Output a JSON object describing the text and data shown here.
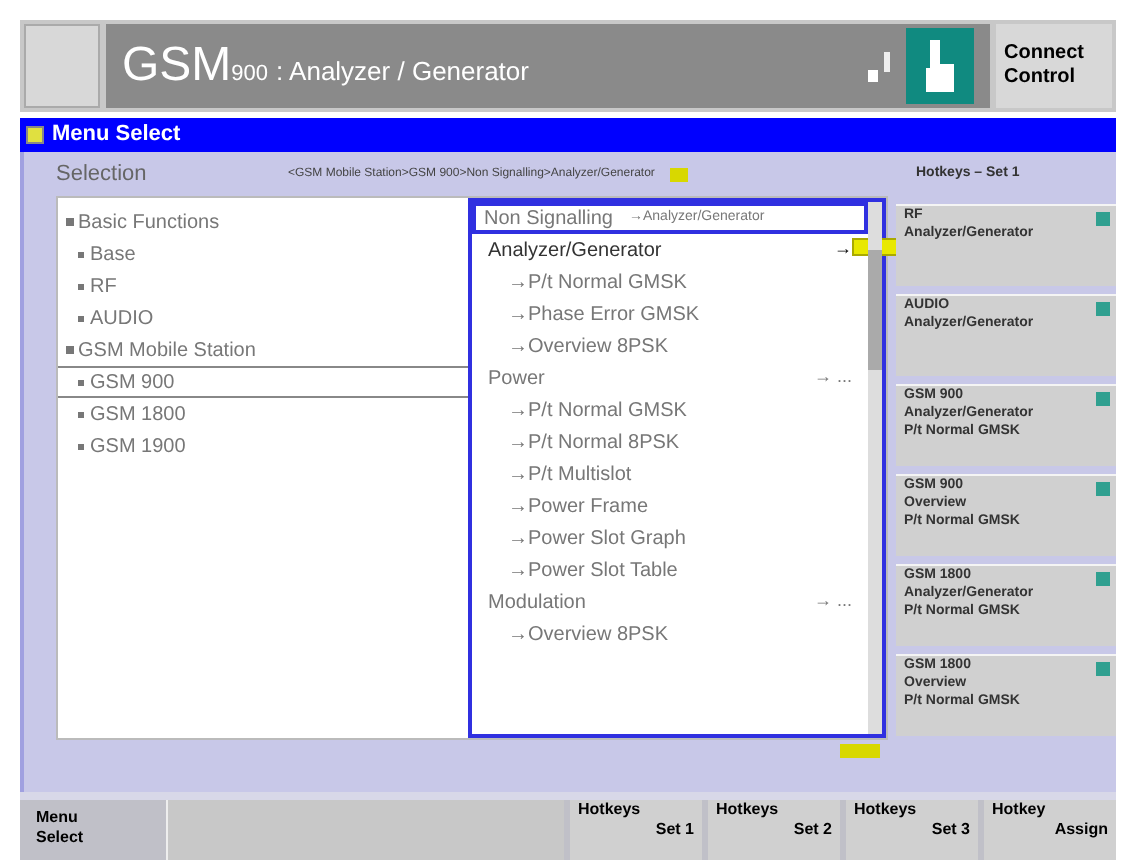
{
  "header": {
    "title_main": "GSM",
    "title_band": "900",
    "title_rest": ": Analyzer / Generator",
    "connect_button": "Connect\nControl"
  },
  "menu_bar": {
    "title": "Menu Select"
  },
  "selection": {
    "label": "Selection",
    "path": "<GSM Mobile Station>GSM 900>Non Signalling>Analyzer/Generator",
    "hotkeys_label": "Hotkeys – Set 1"
  },
  "left_tree": [
    {
      "label": "Basic Functions",
      "expanded": true,
      "selected": false,
      "children": [
        {
          "label": "Base",
          "selected": false
        },
        {
          "label": "RF",
          "selected": false
        },
        {
          "label": "AUDIO",
          "selected": false
        }
      ]
    },
    {
      "label": "GSM Mobile Station",
      "expanded": true,
      "selected": false,
      "children": [
        {
          "label": "GSM 900",
          "selected": true
        },
        {
          "label": "GSM 1800",
          "selected": false
        },
        {
          "label": "GSM 1900",
          "selected": false
        }
      ]
    }
  ],
  "right_header": {
    "label": "Non Signalling",
    "sub": "→Analyzer/Generator"
  },
  "right_tree": [
    {
      "label": "Analyzer/Generator",
      "marker": "→",
      "selected": true,
      "children": [
        {
          "label": "→P/t Normal GMSK"
        },
        {
          "label": "→Phase Error GMSK"
        },
        {
          "label": "→Overview 8PSK"
        }
      ]
    },
    {
      "label": "Power",
      "marker": "→ ...",
      "selected": false,
      "children": [
        {
          "label": "→P/t Normal GMSK"
        },
        {
          "label": "→P/t Normal 8PSK"
        },
        {
          "label": "→P/t Multislot"
        },
        {
          "label": "→Power Frame"
        },
        {
          "label": "→Power Slot Graph"
        },
        {
          "label": "→Power Slot Table"
        }
      ]
    },
    {
      "label": "Modulation",
      "marker": "→ ...",
      "selected": false,
      "children": [
        {
          "label": "→Overview 8PSK"
        }
      ]
    }
  ],
  "softkeys": [
    {
      "lines": [
        "RF",
        "Analyzer/Generator"
      ]
    },
    {
      "lines": [
        "AUDIO",
        "Analyzer/Generator"
      ]
    },
    {
      "lines": [
        "GSM 900",
        "Analyzer/Generator",
        "P/t Normal GMSK"
      ]
    },
    {
      "lines": [
        "GSM 900",
        "Overview",
        "P/t Normal GMSK"
      ]
    },
    {
      "lines": [
        "GSM 1800",
        "Analyzer/Generator",
        "P/t Normal GMSK"
      ]
    },
    {
      "lines": [
        "GSM 1800",
        "Overview",
        "P/t Normal GMSK"
      ]
    }
  ],
  "bottom": {
    "menu_label": "Menu\nSelect",
    "buttons": [
      {
        "top": "Hotkeys",
        "bottom": "Set 1"
      },
      {
        "top": "Hotkeys",
        "bottom": "Set 2"
      },
      {
        "top": "Hotkeys",
        "bottom": "Set 3"
      },
      {
        "top": "Hotkey",
        "bottom": "Assign"
      }
    ]
  }
}
